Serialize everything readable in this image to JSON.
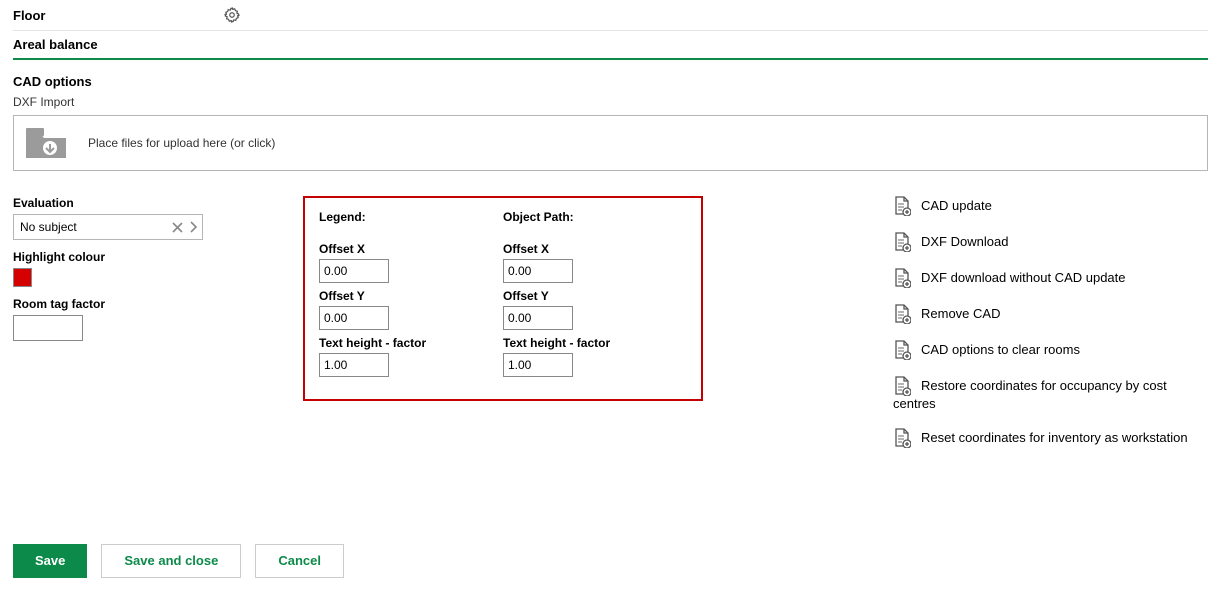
{
  "headers": {
    "floor": "Floor",
    "areal_balance": "Areal balance"
  },
  "section": {
    "title": "CAD options",
    "import_label": "DXF Import",
    "dropzone_hint": "Place files for upload here (or click)"
  },
  "evaluation": {
    "label": "Evaluation",
    "value": "No subject",
    "highlight_label": "Highlight colour",
    "highlight_color": "#d50000",
    "room_tag_label": "Room tag factor",
    "room_tag_value": ""
  },
  "legend": {
    "title": "Legend:",
    "offset_x_label": "Offset X",
    "offset_x": "0.00",
    "offset_y_label": "Offset Y",
    "offset_y": "0.00",
    "text_height_label": "Text height - factor",
    "text_height": "1.00"
  },
  "object_path": {
    "title": "Object Path:",
    "offset_x_label": "Offset X",
    "offset_x": "0.00",
    "offset_y_label": "Offset Y",
    "offset_y": "0.00",
    "text_height_label": "Text height - factor",
    "text_height": "1.00"
  },
  "actions": {
    "cad_update": "CAD update",
    "dxf_download": "DXF Download",
    "dxf_download_no_update": "DXF download without CAD update",
    "remove_cad": "Remove CAD",
    "cad_options_clear": "CAD options to clear rooms",
    "restore_line1": "Restore coordinates for occupancy by cost",
    "restore_line2": "centres",
    "reset_inventory": "Reset coordinates for inventory as workstation"
  },
  "buttons": {
    "save": "Save",
    "save_close": "Save and close",
    "cancel": "Cancel"
  }
}
